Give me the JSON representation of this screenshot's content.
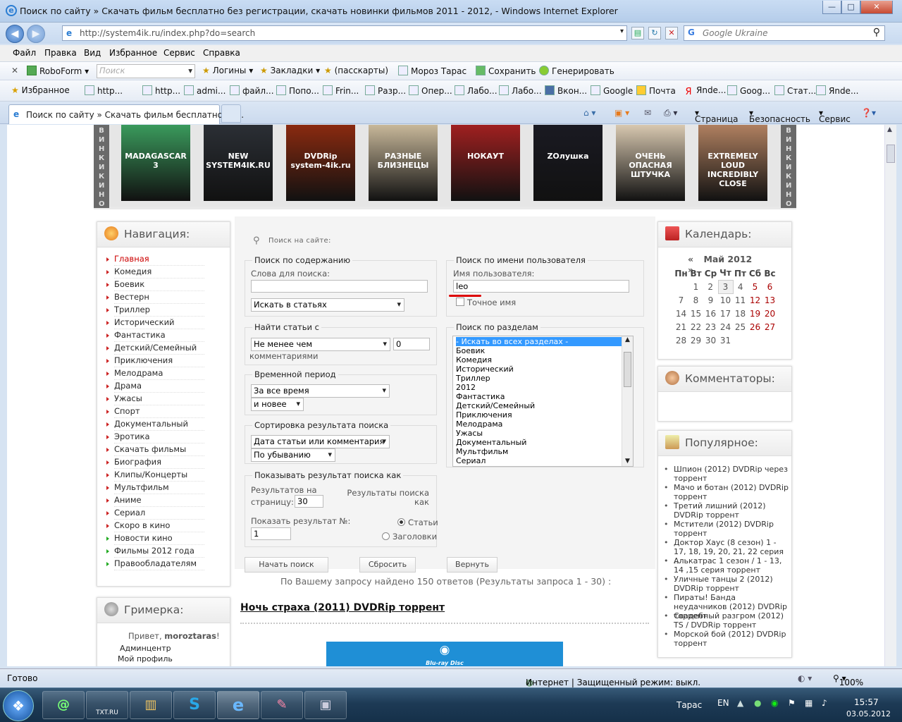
{
  "window": {
    "title": "Поиск по сайту » Скачать фильм бесплатно без регистрации, скачать новинки фильмов 2011 - 2012,  - Windows Internet Explorer",
    "minimize": "—",
    "maximize": "□",
    "close": "✕"
  },
  "address": {
    "url": "http://system4ik.ru/index.php?do=search",
    "search_placeholder": "Google Ukraine"
  },
  "menu": [
    "Файл",
    "Правка",
    "Вид",
    "Избранное",
    "Сервис",
    "Справка"
  ],
  "roboform": {
    "brand": "RoboForm",
    "search_placeholder": "Поиск",
    "logins": "Логины",
    "bookmarks": "Закладки",
    "passcards": "(пасскарты)",
    "user": "Мороз Тарас",
    "save": "Сохранить",
    "generate": "Генерировать"
  },
  "favorites": {
    "label": "Избранное",
    "items": [
      "http...",
      "http...",
      "admi...",
      "файл...",
      "Попо...",
      "Frin...",
      "Разр...",
      "Опер...",
      "Лабо...",
      "Лабо...",
      "Вкон...",
      "Google",
      "Почта",
      "Яnde...",
      "Goog...",
      "Стат...",
      "Яnde..."
    ]
  },
  "tab": {
    "title": "Поиск по сайту » Скачать фильм бесплатно бе..."
  },
  "commands": {
    "page": "Страница",
    "safety": "Безопасность",
    "service": "Сервис"
  },
  "strip": {
    "side_text": "ВИНКИКИНО",
    "posters": [
      {
        "title": "MADAGASCAR 3",
        "bg": "#3a9a5c"
      },
      {
        "title": "NEW SYSTEM4IK.RU",
        "bg": "#2b2f35"
      },
      {
        "title": "DVDRip system-4ik.ru",
        "bg": "#8a2a10"
      },
      {
        "title": "РАЗНЫЕ БЛИЗНЕЦЫ",
        "bg": "#c8b89a"
      },
      {
        "title": "НОКАУТ",
        "bg": "#a02020"
      },
      {
        "title": "ZOлушка",
        "bg": "#1a1a22"
      },
      {
        "title": "ОЧЕНЬ ОПАСНАЯ ШТУЧКА",
        "bg": "#d8c8b0"
      },
      {
        "title": "EXTREMELY LOUD INCREDIBLY CLOSE",
        "bg": "#b08060"
      }
    ]
  },
  "nav": {
    "title": "Навигация:",
    "items": [
      "Главная",
      "Комедия",
      "Боевик",
      "Вестерн",
      "Триллер",
      "Исторический",
      "Фантастика",
      "Детский/Семейный",
      "Приключения",
      "Мелодрама",
      "Драма",
      "Ужасы",
      "Спорт",
      "Документальный",
      "Эротика",
      "Скачать фильмы",
      "Биография",
      "Клипы/Концерты",
      "Мультфильм",
      "Аниме",
      "Сериал",
      "Скоро в кино",
      "Новости кино",
      "Фильмы 2012 года",
      "Правообладателям"
    ]
  },
  "grim": {
    "title": "Гримерка:",
    "hello": "Привет,",
    "user": "moroztaras",
    "links": [
      "Админцентр",
      "Мой профиль"
    ]
  },
  "search": {
    "header": "Поиск на сайте:",
    "content_legend": "Поиск по содержанию",
    "words_label": "Слова для поиска:",
    "words_value": "",
    "in_select": "Искать в статьях",
    "user_legend": "Поиск по имени пользователя",
    "user_label": "Имя пользователя:",
    "user_value": "leo",
    "exact_label": "Точное имя",
    "find_legend": "Найти статьи с",
    "find_select": "Не менее чем",
    "find_value": "0",
    "find_suffix": "комментариями",
    "period_legend": "Временной период",
    "period_select": "За все время",
    "period_newer": "и новее",
    "sort_legend": "Сортировка результата поиска",
    "sort_select": "Дата статьи или комментария",
    "sort_order": "По убыванию",
    "show_legend": "Показывать результат поиска как",
    "per_page_label_1": "Результатов на",
    "per_page_label_2": "страницу:",
    "per_page_value": "30",
    "results_as_1": "Результаты поиска",
    "results_as_2": "как",
    "show_from_label": "Показать результат №:",
    "show_from_value": "1",
    "opt_articles": "Статьи",
    "opt_titles": "Заголовки",
    "sections_legend": "Поиск по разделам",
    "sections": [
      "- Искать во всех разделах -",
      "Боевик",
      "Комедия",
      "Исторический",
      "Триллер",
      "2012",
      "Фантастика",
      "Детский/Семейный",
      "Приключения",
      "Мелодрама",
      "Ужасы",
      "Документальный",
      "Мультфильм",
      "Сериал"
    ],
    "btn_start": "Начать поиск",
    "btn_reset": "Сбросить",
    "btn_back": "Вернуть",
    "result_info": "По Вашему запросу найдено 150 ответов (Результаты запроса 1 - 30) :",
    "first_result": "Ночь страха (2011) DVDRip торрент",
    "bluray": "Blu-ray Disc"
  },
  "calendar": {
    "title": "Календарь:",
    "prev": "«",
    "next": "»",
    "month": "Май 2012",
    "days": [
      "Пн",
      "Вт",
      "Ср",
      "Чт",
      "Пт",
      "Сб",
      "Вс"
    ],
    "weeks": [
      [
        "",
        "1",
        "2",
        "3",
        "4",
        "5",
        "6"
      ],
      [
        "7",
        "8",
        "9",
        "10",
        "11",
        "12",
        "13"
      ],
      [
        "14",
        "15",
        "16",
        "17",
        "18",
        "19",
        "20"
      ],
      [
        "21",
        "22",
        "23",
        "24",
        "25",
        "26",
        "27"
      ],
      [
        "28",
        "29",
        "30",
        "31",
        "",
        "",
        ""
      ]
    ]
  },
  "commentators": {
    "title": "Комментаторы:"
  },
  "popular": {
    "title": "Популярное:",
    "items": [
      "Шпион (2012) DVDRip через торрент",
      "Мачо и ботан (2012) DVDRip торрент",
      "Третий лишний (2012) DVDRip торрент",
      "Мстители (2012) DVDRip торрент",
      "Доктор Хаус (8 сезон) 1 - 17, 18, 19, 20, 21, 22 серия ...",
      "Алькатрас 1 сезон / 1 - 13, 14 ,15 серия торрент",
      "Уличные танцы 2 (2012) DVDRip торрент",
      "Пираты! Банда неудачников (2012) DVDRip торрент",
      "Свадебный разгром (2012) TS / DVDRip торрент",
      "Морской бой (2012) DVDRip торрент"
    ]
  },
  "status": {
    "ready": "Готово",
    "zone": "Интернет | Защищенный режим: выкл.",
    "zoom": "100%"
  },
  "taskbar": {
    "user": "Тарас",
    "lang": "EN",
    "time": "15:57",
    "date": "03.05.2012",
    "apps": [
      "@",
      "TXT.RU",
      "",
      "S",
      "e",
      "",
      ""
    ]
  },
  "colors": {
    "accent_red": "#c00000",
    "link": "#2a2a2a",
    "bluray_bg": "#1f8fd6",
    "select_bg": "#3399ff"
  }
}
